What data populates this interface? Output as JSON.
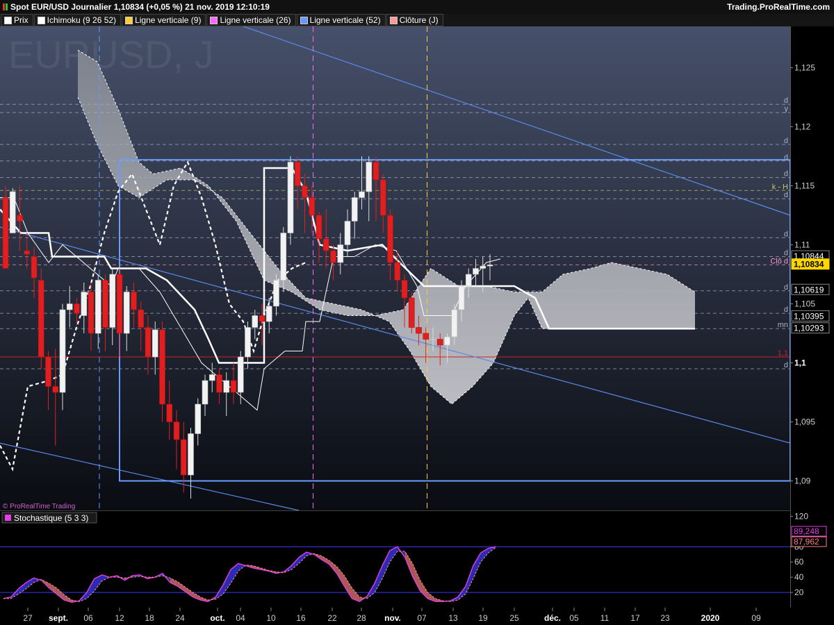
{
  "header": {
    "title": "Spot EUR/USD Journalier 1,10834 (+0,05 %) 21 nov. 2019 12:10:19",
    "site": "Trading.ProRealTime.com"
  },
  "legend": [
    {
      "label": "Prix",
      "color": "#ffffff"
    },
    {
      "label": "Ichimoku (9 26 52)",
      "color": "#ffffff"
    },
    {
      "label": "Ligne verticale (9)",
      "color": "#ffcc33"
    },
    {
      "label": "Ligne verticale (26)",
      "color": "#ff66ff"
    },
    {
      "label": "Ligne verticale (52)",
      "color": "#6699ff"
    },
    {
      "label": "Clôture (J)",
      "color": "#ff9999"
    }
  ],
  "watermark": "EURUSD, J",
  "credit": "© ProRealTime Trading",
  "chart_data": [
    {
      "type": "candlestick",
      "ylim": [
        1.0875,
        1.1285
      ],
      "yticks": [
        "1,125",
        "1,12",
        "1,115",
        "1,11",
        "1,105",
        "1,1",
        "1,095",
        "1,09"
      ],
      "xticks": [
        "27",
        "sept.",
        "06",
        "12",
        "18",
        "24",
        "oct.",
        "04",
        "10",
        "16",
        "22",
        "28",
        "nov.",
        "07",
        "13",
        "19",
        "25",
        "déc.",
        "05",
        "11",
        "17",
        "23",
        "2020",
        "09"
      ],
      "right_labels": [
        {
          "text": "1,10844",
          "value": 1.10844
        },
        {
          "text": "1,10834",
          "value": 1.10834
        },
        {
          "text": "1,10619",
          "value": 1.10619
        },
        {
          "text": "1,10395",
          "value": 1.10395
        },
        {
          "text": "1,10293",
          "value": 1.10293
        }
      ],
      "level_tags": [
        {
          "text": "d",
          "value": 1.1219
        },
        {
          "text": "y",
          "value": 1.1212
        },
        {
          "text": "d",
          "value": 1.1185
        },
        {
          "text": "d",
          "value": 1.1171
        },
        {
          "text": "d",
          "value": 1.1157
        },
        {
          "text": "k - H",
          "value": 1.1146
        },
        {
          "text": "d",
          "value": 1.1139
        },
        {
          "text": "d",
          "value": 1.1106
        },
        {
          "text": "d",
          "value": 1.109
        },
        {
          "text": "Clô d",
          "value": 1.1083
        },
        {
          "text": "d",
          "value": 1.1061
        },
        {
          "text": "d",
          "value": 1.1042
        },
        {
          "text": "mn",
          "value": 1.1029
        },
        {
          "text": "1,1",
          "value": 1.1005
        },
        {
          "text": "d",
          "value": 1.0995
        }
      ],
      "candles": [
        [
          1.114,
          1.115,
          1.1085,
          1.1082,
          1.108
        ],
        [
          1.111,
          1.1148,
          1.1105,
          1.111,
          1.1145
        ],
        [
          1.1125,
          1.115,
          1.108,
          1.1095,
          1.112
        ],
        [
          1.1095,
          1.111,
          1.1075,
          1.108,
          1.1092
        ],
        [
          1.109,
          1.1098,
          1.1065,
          1.1055,
          1.1072
        ],
        [
          1.107,
          1.108,
          1.102,
          1.0995,
          1.1005
        ],
        [
          1.1005,
          1.101,
          1.0965,
          1.096,
          1.098
        ],
        [
          1.098,
          1.1012,
          1.097,
          1.093,
          1.0975
        ],
        [
          1.0975,
          1.105,
          1.0972,
          1.096,
          1.1045
        ],
        [
          1.1045,
          1.1065,
          1.104,
          1.103,
          1.105
        ],
        [
          1.105,
          1.1055,
          1.1035,
          1.1032,
          1.1042
        ],
        [
          1.104,
          1.1068,
          1.103,
          1.1025,
          1.106
        ],
        [
          1.106,
          1.1068,
          1.102,
          1.101,
          1.1025
        ],
        [
          1.1025,
          1.1075,
          1.1015,
          1.1012,
          1.107
        ],
        [
          1.107,
          1.1075,
          1.1025,
          1.101,
          1.103
        ],
        [
          1.103,
          1.108,
          1.102,
          1.1015,
          1.1075
        ],
        [
          1.1075,
          1.108,
          1.1015,
          1.1005,
          1.1025
        ],
        [
          1.1025,
          1.1065,
          1.102,
          1.101,
          1.106
        ],
        [
          1.106,
          1.1068,
          1.104,
          1.103,
          1.1045
        ],
        [
          1.1045,
          1.1052,
          1.102,
          1.101,
          1.103
        ],
        [
          1.103,
          1.104,
          1.1,
          1.099,
          1.1005
        ],
        [
          1.1005,
          1.1035,
          1.1,
          1.099,
          1.1028
        ],
        [
          1.1028,
          1.1035,
          1.096,
          1.095,
          1.0965
        ],
        [
          1.0965,
          1.0985,
          1.094,
          1.0935,
          1.095
        ],
        [
          1.095,
          1.096,
          1.093,
          1.091,
          1.0935
        ],
        [
          1.0935,
          1.095,
          1.09,
          1.089,
          1.0905
        ],
        [
          1.0905,
          1.0945,
          1.09,
          1.0885,
          1.094
        ],
        [
          1.094,
          1.097,
          1.0935,
          1.093,
          1.0965
        ],
        [
          1.0965,
          1.099,
          1.096,
          1.0955,
          1.0985
        ],
        [
          1.0985,
          1.1,
          1.098,
          1.0975,
          1.099
        ],
        [
          1.099,
          1.0995,
          1.097,
          1.0965,
          1.0975
        ],
        [
          1.0975,
          1.0992,
          1.097,
          1.0955,
          1.0985
        ],
        [
          1.0985,
          1.1,
          1.097,
          1.0965,
          1.0975
        ],
        [
          1.0975,
          1.101,
          1.097,
          1.0965,
          1.1005
        ],
        [
          1.1005,
          1.1035,
          1.1,
          1.0995,
          1.103
        ],
        [
          1.103,
          1.1045,
          1.1025,
          1.102,
          1.104
        ],
        [
          1.104,
          1.105,
          1.102,
          1.1015,
          1.1035
        ],
        [
          1.1035,
          1.1055,
          1.103,
          1.1025,
          1.1048
        ],
        [
          1.1048,
          1.1075,
          1.1045,
          1.104,
          1.107
        ],
        [
          1.107,
          1.1115,
          1.1065,
          1.106,
          1.111
        ],
        [
          1.111,
          1.1175,
          1.1105,
          1.11,
          1.117
        ],
        [
          1.117,
          1.1175,
          1.114,
          1.113,
          1.115
        ],
        [
          1.115,
          1.116,
          1.112,
          1.111,
          1.114
        ],
        [
          1.114,
          1.115,
          1.1115,
          1.111,
          1.1125
        ],
        [
          1.1125,
          1.1128,
          1.11,
          1.1085,
          1.1105
        ],
        [
          1.1105,
          1.113,
          1.1095,
          1.108,
          1.1095
        ],
        [
          1.1095,
          1.11,
          1.108,
          1.107,
          1.1085
        ],
        [
          1.1085,
          1.111,
          1.108,
          1.1075,
          1.11
        ],
        [
          1.11,
          1.113,
          1.1095,
          1.109,
          1.112
        ],
        [
          1.112,
          1.1145,
          1.1115,
          1.1105,
          1.114
        ],
        [
          1.114,
          1.1175,
          1.1135,
          1.113,
          1.1145
        ],
        [
          1.1145,
          1.1175,
          1.114,
          1.112,
          1.117
        ],
        [
          1.117,
          1.1175,
          1.1145,
          1.112,
          1.1155
        ],
        [
          1.1155,
          1.116,
          1.112,
          1.111,
          1.1125
        ],
        [
          1.1125,
          1.113,
          1.108,
          1.107,
          1.1085
        ],
        [
          1.1085,
          1.1095,
          1.1065,
          1.106,
          1.107
        ],
        [
          1.107,
          1.1075,
          1.104,
          1.103,
          1.1055
        ],
        [
          1.1055,
          1.106,
          1.103,
          1.1025,
          1.103
        ],
        [
          1.103,
          1.104,
          1.102,
          1.1015,
          1.1025
        ],
        [
          1.1025,
          1.103,
          1.1015,
          1.1,
          1.102
        ],
        [
          1.102,
          1.103,
          1.1015,
          1.101,
          1.102
        ],
        [
          1.102,
          1.1025,
          1.101,
          1.0998,
          1.1015
        ],
        [
          1.1015,
          1.1025,
          1.1005,
          1.1,
          1.1022
        ],
        [
          1.1022,
          1.105,
          1.102,
          1.1015,
          1.1045
        ],
        [
          1.1045,
          1.107,
          1.104,
          1.1035,
          1.1065
        ],
        [
          1.1065,
          1.108,
          1.106,
          1.1055,
          1.1075
        ],
        [
          1.1075,
          1.1088,
          1.107,
          1.1065,
          1.108
        ],
        [
          1.108,
          1.109,
          1.1072,
          1.106,
          1.1082
        ],
        [
          1.1082,
          1.1092,
          1.1075,
          1.107,
          1.1083
        ]
      ],
      "vertical_lines": [
        {
          "x_index": 12,
          "color": "#6699ff"
        },
        {
          "x_index": 42,
          "color": "#ff66ff"
        },
        {
          "x_index": 58,
          "color": "#ffcc33"
        }
      ]
    },
    {
      "type": "line",
      "title": "Stochastique (5 3 3)",
      "ylim": [
        0,
        125
      ],
      "yticks": [
        "120",
        "80",
        "60",
        "40",
        "20"
      ],
      "levels": [
        80,
        20
      ],
      "last_values": [
        {
          "text": "89,248",
          "color": "#e040e0"
        },
        {
          "text": "87,962",
          "color": "#ff8080"
        }
      ],
      "k": [
        12,
        14,
        25,
        33,
        39,
        36,
        26,
        18,
        10,
        7,
        9,
        20,
        38,
        43,
        40,
        42,
        36,
        42,
        43,
        38,
        40,
        45,
        33,
        28,
        21,
        14,
        10,
        8,
        14,
        30,
        50,
        58,
        55,
        52,
        50,
        48,
        45,
        47,
        55,
        66,
        73,
        70,
        63,
        57,
        45,
        28,
        12,
        8,
        15,
        32,
        55,
        75,
        80,
        66,
        41,
        22,
        12,
        8,
        8,
        9,
        14,
        28,
        55,
        72,
        78,
        80
      ],
      "d": [
        12,
        12,
        18,
        25,
        33,
        37,
        32,
        26,
        17,
        10,
        8,
        12,
        22,
        35,
        40,
        40,
        39,
        40,
        41,
        40,
        40,
        42,
        39,
        34,
        27,
        20,
        14,
        10,
        11,
        18,
        32,
        48,
        56,
        55,
        52,
        49,
        47,
        46,
        50,
        58,
        68,
        71,
        68,
        62,
        54,
        42,
        26,
        14,
        12,
        20,
        38,
        60,
        74,
        74,
        58,
        36,
        20,
        12,
        9,
        8,
        10,
        18,
        38,
        60,
        72,
        79
      ]
    }
  ]
}
